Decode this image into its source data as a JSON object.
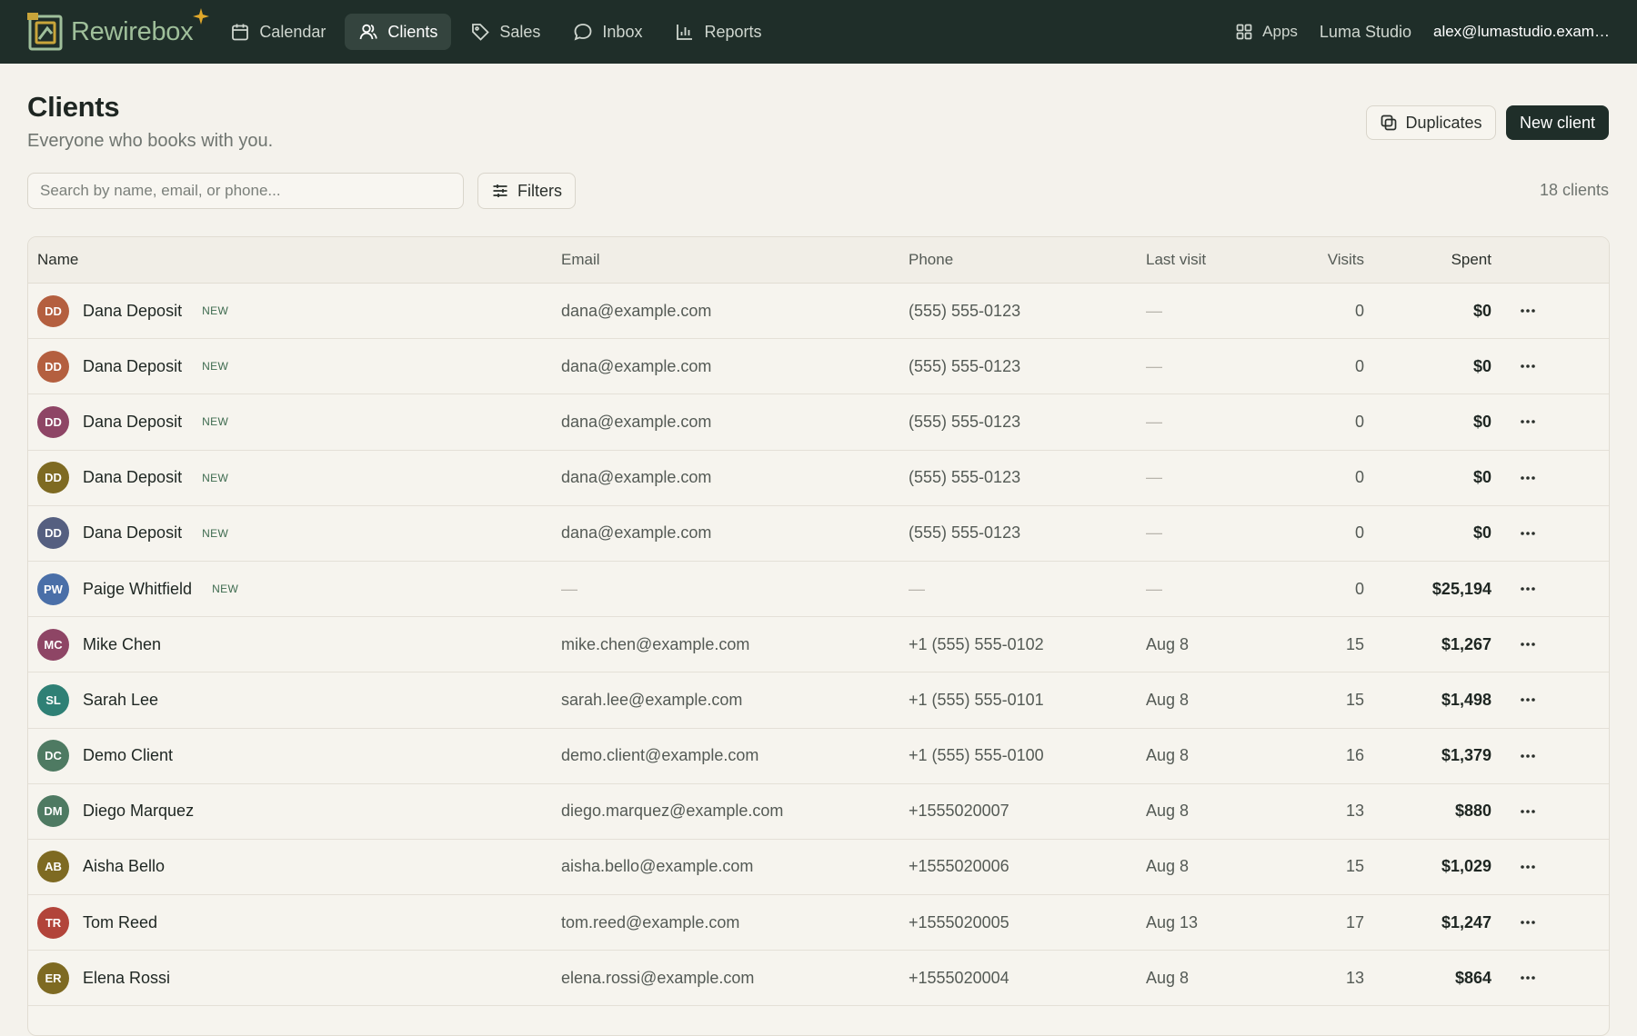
{
  "brand": {
    "name": "Rewirebox"
  },
  "nav": [
    {
      "label": "Calendar",
      "icon": "calendar-icon",
      "active": false
    },
    {
      "label": "Clients",
      "icon": "clients-icon",
      "active": true
    },
    {
      "label": "Sales",
      "icon": "tag-icon",
      "active": false
    },
    {
      "label": "Inbox",
      "icon": "chat-bubble-icon",
      "active": false
    },
    {
      "label": "Reports",
      "icon": "bar-chart-icon",
      "active": false
    }
  ],
  "topbar": {
    "apps_label": "Apps",
    "studio": "Luma Studio",
    "account": "alex@lumastudio.example.com"
  },
  "page": {
    "title": "Clients",
    "subtitle": "Everyone who books with you.",
    "duplicates_label": "Duplicates",
    "new_client_label": "New client"
  },
  "search": {
    "placeholder": "Search by name, email, or phone...",
    "value": ""
  },
  "filters_label": "Filters",
  "client_count": "18 clients",
  "table": {
    "columns": {
      "name": "Name",
      "email": "Email",
      "phone": "Phone",
      "last_visit": "Last visit",
      "visits": "Visits",
      "spent": "Spent"
    },
    "rows": [
      {
        "initials": "DD",
        "name": "Dana Deposit",
        "badge": "NEW",
        "email": "dana@example.com",
        "phone": "(555) 555-0123",
        "last_visit": "—",
        "visits": "0",
        "spent": "$0",
        "avatar_color": "#b45f3f"
      },
      {
        "initials": "DD",
        "name": "Dana Deposit",
        "badge": "NEW",
        "email": "dana@example.com",
        "phone": "(555) 555-0123",
        "last_visit": "—",
        "visits": "0",
        "spent": "$0",
        "avatar_color": "#b45f3f"
      },
      {
        "initials": "DD",
        "name": "Dana Deposit",
        "badge": "NEW",
        "email": "dana@example.com",
        "phone": "(555) 555-0123",
        "last_visit": "—",
        "visits": "0",
        "spent": "$0",
        "avatar_color": "#8e4565"
      },
      {
        "initials": "DD",
        "name": "Dana Deposit",
        "badge": "NEW",
        "email": "dana@example.com",
        "phone": "(555) 555-0123",
        "last_visit": "—",
        "visits": "0",
        "spent": "$0",
        "avatar_color": "#7e6a22"
      },
      {
        "initials": "DD",
        "name": "Dana Deposit",
        "badge": "NEW",
        "email": "dana@example.com",
        "phone": "(555) 555-0123",
        "last_visit": "—",
        "visits": "0",
        "spent": "$0",
        "avatar_color": "#555f80"
      },
      {
        "initials": "PW",
        "name": "Paige Whitfield",
        "badge": "NEW",
        "email": "—",
        "phone": "—",
        "last_visit": "—",
        "visits": "0",
        "spent": "$25,194",
        "avatar_color": "#4a6fa8"
      },
      {
        "initials": "MC",
        "name": "Mike Chen",
        "badge": "",
        "email": "mike.chen@example.com",
        "phone": "+1 (555) 555-0102",
        "last_visit": "Aug 8",
        "visits": "15",
        "spent": "$1,267",
        "avatar_color": "#8e4565"
      },
      {
        "initials": "SL",
        "name": "Sarah Lee",
        "badge": "",
        "email": "sarah.lee@example.com",
        "phone": "+1 (555) 555-0101",
        "last_visit": "Aug 8",
        "visits": "15",
        "spent": "$1,498",
        "avatar_color": "#2f8075"
      },
      {
        "initials": "DC",
        "name": "Demo Client",
        "badge": "",
        "email": "demo.client@example.com",
        "phone": "+1 (555) 555-0100",
        "last_visit": "Aug 8",
        "visits": "16",
        "spent": "$1,379",
        "avatar_color": "#4e7a62"
      },
      {
        "initials": "DM",
        "name": "Diego Marquez",
        "badge": "",
        "email": "diego.marquez@example.com",
        "phone": "+1555020007",
        "last_visit": "Aug 8",
        "visits": "13",
        "spent": "$880",
        "avatar_color": "#4e7a62"
      },
      {
        "initials": "AB",
        "name": "Aisha Bello",
        "badge": "",
        "email": "aisha.bello@example.com",
        "phone": "+1555020006",
        "last_visit": "Aug 8",
        "visits": "15",
        "spent": "$1,029",
        "avatar_color": "#7e6a22"
      },
      {
        "initials": "TR",
        "name": "Tom Reed",
        "badge": "",
        "email": "tom.reed@example.com",
        "phone": "+1555020005",
        "last_visit": "Aug 13",
        "visits": "17",
        "spent": "$1,247",
        "avatar_color": "#b2443a"
      },
      {
        "initials": "ER",
        "name": "Elena Rossi",
        "badge": "",
        "email": "elena.rossi@example.com",
        "phone": "+1555020004",
        "last_visit": "Aug 8",
        "visits": "13",
        "spent": "$864",
        "avatar_color": "#7e6a22"
      },
      {
        "initials": "",
        "name": "",
        "badge": "",
        "email": "",
        "phone": "",
        "last_visit": "",
        "visits": "",
        "spent": "",
        "avatar_color": "#b45f3f"
      }
    ]
  },
  "colors": {
    "topbar_bg": "#1f2e29",
    "page_bg": "#f4f2ec",
    "primary_button": "#1f2e29",
    "badge_text": "#3e6b4f"
  }
}
